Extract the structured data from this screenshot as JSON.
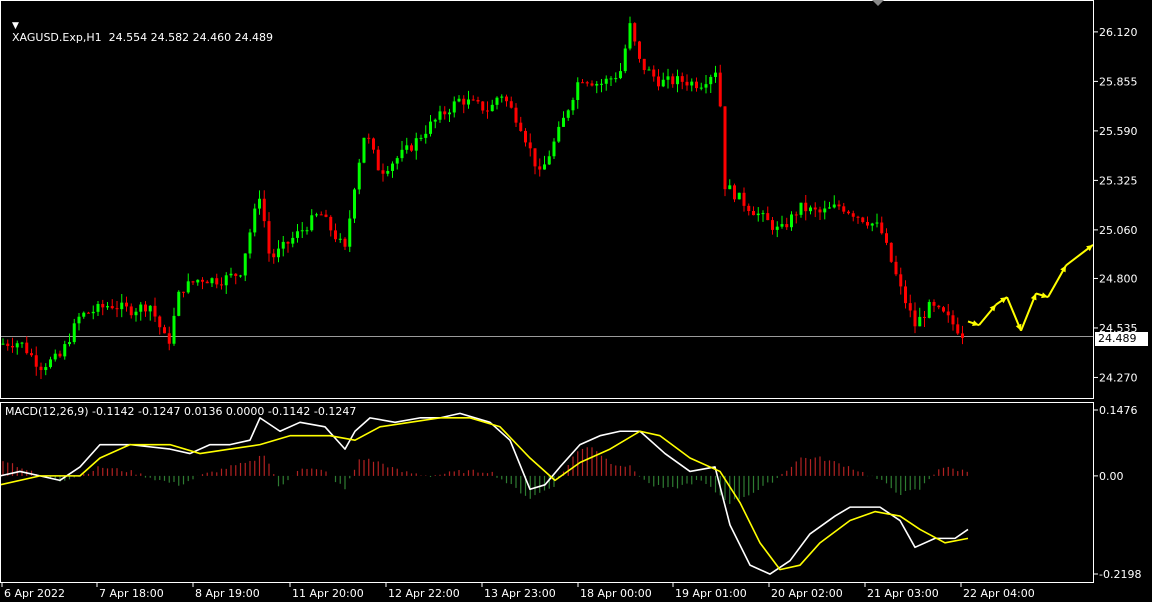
{
  "header": {
    "triangle_icon": "triangle-down-icon",
    "symbol": "XAGUSD.Exp,H1",
    "ohlc": "24.554 24.582 24.460 24.489"
  },
  "macd": {
    "label": "MACD(12,26,9) -0.1142 -0.1247 0.0136 0.0000 -0.1142 -0.1247"
  },
  "colors": {
    "background": "#000000",
    "bull_candle": "#00ff00",
    "bear_candle": "#ff0000",
    "macd_line": "#ffffff",
    "signal_line": "#ffff00",
    "projection": "#ffff00",
    "hist_pos": "#b22222",
    "hist_neg": "#2e7d32"
  },
  "price_tag": "24.489",
  "chart_data": [
    {
      "type": "candlestick",
      "title": "XAGUSD.Exp,H1",
      "y_ticks": [
        "26.120",
        "25.855",
        "25.590",
        "25.325",
        "25.060",
        "24.800",
        "24.535",
        "24.270"
      ],
      "y_tick_values": [
        26.12,
        25.855,
        25.59,
        25.325,
        25.06,
        24.8,
        24.535,
        24.27
      ],
      "ylim": [
        24.16,
        26.28
      ],
      "x_ticks": [
        "6 Apr 2022",
        "7 Apr 18:00",
        "8 Apr 19:00",
        "11 Apr 20:00",
        "12 Apr 22:00",
        "13 Apr 23:00",
        "18 Apr 00:00",
        "19 Apr 01:00",
        "20 Apr 02:00",
        "21 Apr 03:00",
        "22 Apr 04:00"
      ],
      "current_price": 24.489,
      "anchors": [
        [
          0,
          24.45
        ],
        [
          20,
          24.46
        ],
        [
          40,
          24.33
        ],
        [
          60,
          24.38
        ],
        [
          80,
          24.6
        ],
        [
          110,
          24.66
        ],
        [
          130,
          24.63
        ],
        [
          150,
          24.66
        ],
        [
          168,
          24.44
        ],
        [
          180,
          24.74
        ],
        [
          200,
          24.8
        ],
        [
          220,
          24.79
        ],
        [
          240,
          24.83
        ],
        [
          250,
          25.05
        ],
        [
          260,
          25.26
        ],
        [
          270,
          24.9
        ],
        [
          290,
          25.0
        ],
        [
          320,
          25.15
        ],
        [
          345,
          24.95
        ],
        [
          355,
          25.32
        ],
        [
          365,
          25.59
        ],
        [
          380,
          25.37
        ],
        [
          410,
          25.5
        ],
        [
          430,
          25.62
        ],
        [
          460,
          25.76
        ],
        [
          490,
          25.7
        ],
        [
          500,
          25.8
        ],
        [
          520,
          25.63
        ],
        [
          540,
          25.35
        ],
        [
          560,
          25.6
        ],
        [
          580,
          25.88
        ],
        [
          600,
          25.84
        ],
        [
          620,
          25.9
        ],
        [
          630,
          26.15
        ],
        [
          640,
          25.95
        ],
        [
          660,
          25.85
        ],
        [
          680,
          25.86
        ],
        [
          700,
          25.84
        ],
        [
          718,
          25.93
        ],
        [
          725,
          25.3
        ],
        [
          745,
          25.2
        ],
        [
          780,
          25.05
        ],
        [
          800,
          25.18
        ],
        [
          820,
          25.15
        ],
        [
          840,
          25.19
        ],
        [
          860,
          25.13
        ],
        [
          880,
          25.07
        ],
        [
          900,
          24.75
        ],
        [
          915,
          24.55
        ],
        [
          930,
          24.65
        ],
        [
          945,
          24.6
        ],
        [
          965,
          24.49
        ]
      ],
      "projection": [
        [
          24.57,
          24.42
        ],
        [
          24.55,
          24.42
        ],
        [
          24.66,
          24.5
        ],
        [
          24.7,
          24.5
        ],
        [
          24.52,
          24.4
        ],
        [
          24.72,
          24.4
        ],
        [
          24.7,
          24.52
        ],
        [
          24.87,
          24.52
        ],
        [
          24.98,
          25.06
        ]
      ]
    },
    {
      "type": "line",
      "title": "MACD(12,26,9)",
      "y_ticks": [
        "0.1476",
        "0.00",
        "-0.2198"
      ],
      "y_tick_values": [
        0.1476,
        0.0,
        -0.2198
      ],
      "ylim": [
        -0.2198,
        0.1476
      ],
      "series": [
        {
          "name": "MACD",
          "points": [
            [
              0,
              0.0
            ],
            [
              20,
              0.01
            ],
            [
              40,
              0.0
            ],
            [
              60,
              -0.01
            ],
            [
              80,
              0.02
            ],
            [
              100,
              0.07
            ],
            [
              130,
              0.07
            ],
            [
              170,
              0.06
            ],
            [
              190,
              0.05
            ],
            [
              210,
              0.07
            ],
            [
              230,
              0.07
            ],
            [
              250,
              0.08
            ],
            [
              260,
              0.13
            ],
            [
              280,
              0.1
            ],
            [
              300,
              0.12
            ],
            [
              325,
              0.11
            ],
            [
              345,
              0.06
            ],
            [
              355,
              0.1
            ],
            [
              370,
              0.13
            ],
            [
              395,
              0.12
            ],
            [
              420,
              0.13
            ],
            [
              440,
              0.13
            ],
            [
              460,
              0.14
            ],
            [
              490,
              0.12
            ],
            [
              510,
              0.08
            ],
            [
              530,
              -0.03
            ],
            [
              545,
              -0.02
            ],
            [
              560,
              0.02
            ],
            [
              580,
              0.07
            ],
            [
              600,
              0.09
            ],
            [
              620,
              0.1
            ],
            [
              640,
              0.1
            ],
            [
              665,
              0.05
            ],
            [
              690,
              0.01
            ],
            [
              715,
              0.02
            ],
            [
              730,
              -0.11
            ],
            [
              750,
              -0.2
            ],
            [
              770,
              -0.22
            ],
            [
              790,
              -0.19
            ],
            [
              810,
              -0.13
            ],
            [
              835,
              -0.09
            ],
            [
              850,
              -0.07
            ],
            [
              880,
              -0.07
            ],
            [
              900,
              -0.1
            ],
            [
              915,
              -0.16
            ],
            [
              935,
              -0.14
            ],
            [
              955,
              -0.14
            ],
            [
              968,
              -0.12
            ]
          ]
        },
        {
          "name": "Signal",
          "points": [
            [
              0,
              -0.02
            ],
            [
              40,
              0.0
            ],
            [
              80,
              0.0
            ],
            [
              100,
              0.04
            ],
            [
              130,
              0.07
            ],
            [
              170,
              0.07
            ],
            [
              200,
              0.05
            ],
            [
              230,
              0.06
            ],
            [
              260,
              0.07
            ],
            [
              290,
              0.09
            ],
            [
              330,
              0.09
            ],
            [
              355,
              0.08
            ],
            [
              380,
              0.11
            ],
            [
              410,
              0.12
            ],
            [
              440,
              0.13
            ],
            [
              470,
              0.13
            ],
            [
              500,
              0.11
            ],
            [
              530,
              0.04
            ],
            [
              555,
              -0.01
            ],
            [
              580,
              0.03
            ],
            [
              610,
              0.06
            ],
            [
              640,
              0.1
            ],
            [
              660,
              0.09
            ],
            [
              690,
              0.04
            ],
            [
              720,
              0.01
            ],
            [
              740,
              -0.06
            ],
            [
              760,
              -0.15
            ],
            [
              780,
              -0.21
            ],
            [
              800,
              -0.2
            ],
            [
              820,
              -0.15
            ],
            [
              850,
              -0.1
            ],
            [
              875,
              -0.08
            ],
            [
              900,
              -0.09
            ],
            [
              920,
              -0.12
            ],
            [
              945,
              -0.15
            ],
            [
              968,
              -0.14
            ]
          ]
        },
        {
          "name": "Histogram",
          "points": [
            [
              0,
              0.04
            ],
            [
              20,
              0.02
            ],
            [
              40,
              0.0
            ],
            [
              60,
              -0.01
            ],
            [
              80,
              0.0
            ],
            [
              100,
              0.02
            ],
            [
              130,
              0.01
            ],
            [
              160,
              -0.01
            ],
            [
              180,
              -0.02
            ],
            [
              200,
              0.0
            ],
            [
              230,
              0.02
            ],
            [
              250,
              0.03
            ],
            [
              265,
              0.05
            ],
            [
              280,
              -0.03
            ],
            [
              300,
              0.02
            ],
            [
              325,
              0.01
            ],
            [
              345,
              -0.03
            ],
            [
              360,
              0.04
            ],
            [
              380,
              0.03
            ],
            [
              400,
              0.01
            ],
            [
              430,
              0.0
            ],
            [
              460,
              0.01
            ],
            [
              490,
              0.01
            ],
            [
              510,
              -0.02
            ],
            [
              530,
              -0.05
            ],
            [
              555,
              -0.02
            ],
            [
              575,
              0.05
            ],
            [
              590,
              0.07
            ],
            [
              610,
              0.03
            ],
            [
              630,
              0.02
            ],
            [
              650,
              -0.02
            ],
            [
              670,
              -0.03
            ],
            [
              700,
              -0.01
            ],
            [
              730,
              -0.06
            ],
            [
              760,
              -0.03
            ],
            [
              780,
              0.0
            ],
            [
              800,
              0.04
            ],
            [
              820,
              0.04
            ],
            [
              850,
              0.02
            ],
            [
              880,
              -0.01
            ],
            [
              900,
              -0.04
            ],
            [
              920,
              -0.03
            ],
            [
              940,
              0.02
            ],
            [
              968,
              0.01
            ]
          ]
        }
      ]
    }
  ]
}
